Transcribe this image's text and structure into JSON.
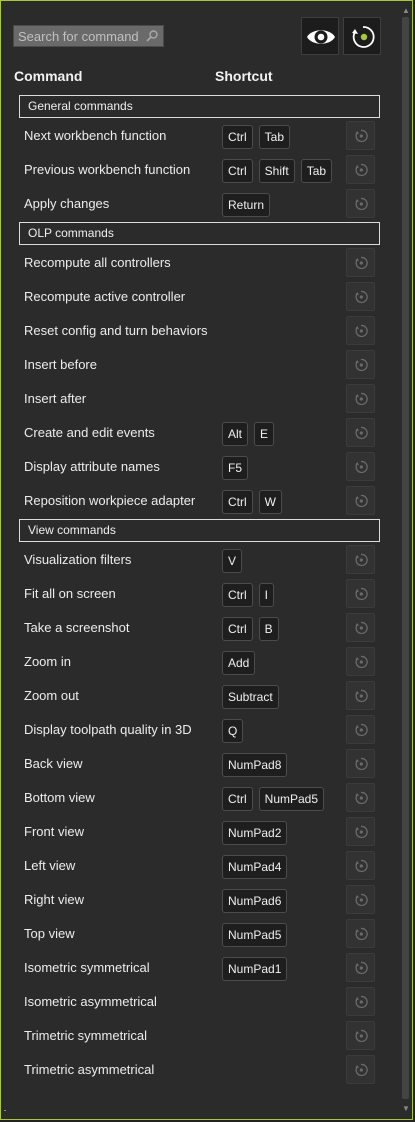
{
  "search": {
    "placeholder": "Search for command",
    "value": ""
  },
  "toolbar": {
    "view_icon": "eye-icon",
    "reset_all_icon": "reset-icon"
  },
  "columns": {
    "command": "Command",
    "shortcut": "Shortcut"
  },
  "colors": {
    "accent": "#a6c93a",
    "background": "#2b2b2b",
    "key_bg": "#1e1e1e"
  },
  "sections": [
    {
      "title": "General commands",
      "rows": [
        {
          "label": "Next workbench function",
          "keys": [
            "Ctrl",
            "Tab"
          ]
        },
        {
          "label": "Previous workbench function",
          "keys": [
            "Ctrl",
            "Shift",
            "Tab"
          ]
        },
        {
          "label": "Apply changes",
          "keys": [
            "Return"
          ]
        }
      ]
    },
    {
      "title": "OLP commands",
      "rows": [
        {
          "label": "Recompute all controllers",
          "keys": []
        },
        {
          "label": "Recompute active controller",
          "keys": []
        },
        {
          "label": "Reset config and turn behaviors",
          "keys": []
        },
        {
          "label": "Insert before",
          "keys": []
        },
        {
          "label": "Insert after",
          "keys": []
        },
        {
          "label": "Create and edit events",
          "keys": [
            "Alt",
            "E"
          ]
        },
        {
          "label": "Display attribute names",
          "keys": [
            "F5"
          ]
        },
        {
          "label": "Reposition workpiece adapter",
          "keys": [
            "Ctrl",
            "W"
          ]
        }
      ]
    },
    {
      "title": "View commands",
      "rows": [
        {
          "label": "Visualization filters",
          "keys": [
            "V"
          ]
        },
        {
          "label": "Fit all on screen",
          "keys": [
            "Ctrl",
            "I"
          ]
        },
        {
          "label": "Take a screenshot",
          "keys": [
            "Ctrl",
            "B"
          ]
        },
        {
          "label": "Zoom in",
          "keys": [
            "Add"
          ]
        },
        {
          "label": "Zoom out",
          "keys": [
            "Subtract"
          ]
        },
        {
          "label": "Display toolpath quality in 3D",
          "keys": [
            "Q"
          ]
        },
        {
          "label": "Back view",
          "keys": [
            "NumPad8"
          ]
        },
        {
          "label": "Bottom view",
          "keys": [
            "Ctrl",
            "NumPad5"
          ]
        },
        {
          "label": "Front view",
          "keys": [
            "NumPad2"
          ]
        },
        {
          "label": "Left view",
          "keys": [
            "NumPad4"
          ]
        },
        {
          "label": "Right view",
          "keys": [
            "NumPad6"
          ]
        },
        {
          "label": "Top view",
          "keys": [
            "NumPad5"
          ]
        },
        {
          "label": "Isometric symmetrical",
          "keys": [
            "NumPad1"
          ]
        },
        {
          "label": "Isometric asymmetrical",
          "keys": []
        },
        {
          "label": "Trimetric symmetrical",
          "keys": []
        },
        {
          "label": "Trimetric asymmetrical",
          "keys": []
        }
      ]
    }
  ]
}
